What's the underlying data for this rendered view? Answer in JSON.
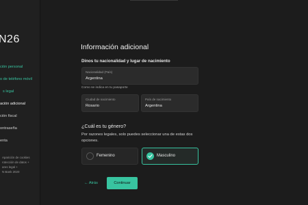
{
  "app": {
    "logo": "N26"
  },
  "sidebar": {
    "items": [
      {
        "label": "ción personal"
      },
      {
        "label": "o de teléfono móvil"
      },
      {
        "label": "s legal"
      },
      {
        "label": "ación adicional"
      },
      {
        "label": "ción fiscal"
      },
      {
        "label": "ontraseña"
      },
      {
        "label": "enta"
      }
    ],
    "footer": [
      "Aparición de cookies",
      "rotección de datos +",
      "ares legal +",
      "N Bank 2020"
    ]
  },
  "form": {
    "title": "Información adicional",
    "section_label": "Dinos tu nacionalidad y lugar de nacimiento",
    "nationality": {
      "label": "Nacionalidad (País)",
      "value": "Argentina"
    },
    "hint": "Como se indica en tu pasaporte",
    "birth_city": {
      "label": "Ciudad de nacimiento",
      "value": "Rosario"
    },
    "birth_country": {
      "label": "País de nacimiento",
      "value": "Argentina"
    }
  },
  "gender": {
    "question": "¿Cuál es tu género?",
    "description": "Por razones legales, solo puedes seleccionar una de estas dos opciones.",
    "options": [
      {
        "label": "Femenino",
        "selected": false
      },
      {
        "label": "Masculino",
        "selected": true
      }
    ]
  },
  "actions": {
    "back_label": "← Atrás",
    "continue_label": "Continuar"
  },
  "colors": {
    "accent": "#38c4a0",
    "background": "#1c1c1c",
    "sidebar": "#202020"
  }
}
